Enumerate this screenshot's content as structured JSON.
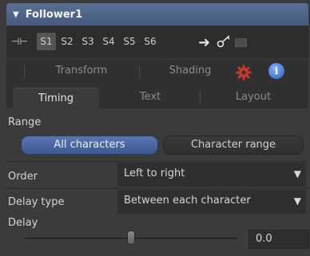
{
  "header": {
    "title": "Follower1"
  },
  "versions": {
    "items": [
      "S1",
      "S2",
      "S3",
      "S4",
      "S5",
      "S6"
    ],
    "active": "S1"
  },
  "tabs_row1": [
    "Transform",
    "Shading"
  ],
  "tabs_row2": [
    "Timing",
    "Text",
    "Layout"
  ],
  "active_tab": "Timing",
  "range": {
    "label": "Range",
    "options": [
      "All characters",
      "Character range"
    ],
    "selected": "All characters"
  },
  "order": {
    "label": "Order",
    "value": "Left to right"
  },
  "delay_type": {
    "label": "Delay type",
    "value": "Between each character"
  },
  "delay": {
    "label": "Delay",
    "value": "0.0"
  },
  "icons": {
    "collapse": "triangle-down-icon",
    "pin": "pin-icon",
    "arrow": "arrow-right-icon",
    "key": "key-icon",
    "monitor": "monitor-icon",
    "gear": "gear-icon",
    "info": "info-icon"
  },
  "colors": {
    "header": "#4f6488",
    "selected_button": "#4c68a2",
    "gear": "#c0392b"
  }
}
